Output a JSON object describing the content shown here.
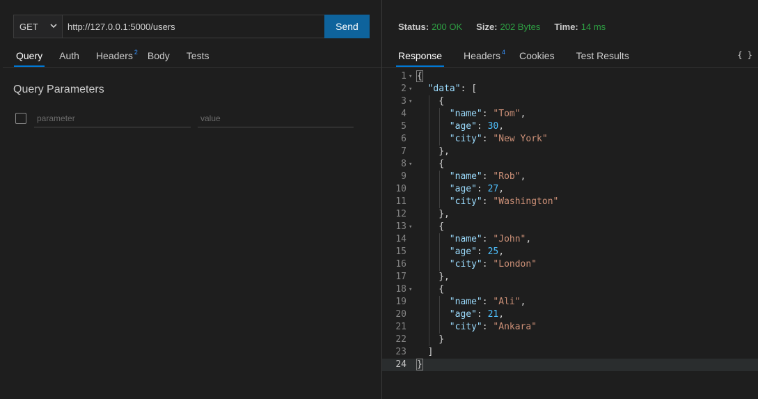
{
  "request": {
    "method": "GET",
    "url": "http://127.0.0.1:5000/users",
    "send_label": "Send"
  },
  "request_tabs": [
    {
      "label": "Query",
      "active": true,
      "badge": ""
    },
    {
      "label": "Auth",
      "active": false,
      "badge": ""
    },
    {
      "label": "Headers",
      "active": false,
      "badge": "2"
    },
    {
      "label": "Body",
      "active": false,
      "badge": ""
    },
    {
      "label": "Tests",
      "active": false,
      "badge": ""
    }
  ],
  "query": {
    "title": "Query Parameters",
    "param_placeholder": "parameter",
    "value_placeholder": "value"
  },
  "status": {
    "status_label": "Status:",
    "status_value": "200 OK",
    "size_label": "Size:",
    "size_value": "202 Bytes",
    "time_label": "Time:",
    "time_value": "14 ms"
  },
  "response_tabs": [
    {
      "label": "Response",
      "active": true,
      "badge": ""
    },
    {
      "label": "Headers",
      "active": false,
      "badge": "4"
    },
    {
      "label": "Cookies",
      "active": false,
      "badge": ""
    },
    {
      "label": "Test Results",
      "active": false,
      "badge": ""
    }
  ],
  "braces_icon": "{ }",
  "colors": {
    "accent": "#0078d4",
    "send_button": "#0e639c",
    "status_green": "#2ea043",
    "json_key": "#9cdcfe",
    "json_string": "#ce9178",
    "json_number": "#b5cea8"
  },
  "response_body": [
    {
      "n": "1",
      "fold": true,
      "indent": 0,
      "tokens": [
        [
          "p",
          "{"
        ]
      ]
    },
    {
      "n": "2",
      "fold": true,
      "indent": 1,
      "tokens": [
        [
          "k",
          "\"data\""
        ],
        [
          "p",
          ": ["
        ]
      ]
    },
    {
      "n": "3",
      "fold": true,
      "indent": 2,
      "tokens": [
        [
          "p",
          "{"
        ]
      ]
    },
    {
      "n": "4",
      "fold": false,
      "indent": 3,
      "tokens": [
        [
          "k",
          "\"name\""
        ],
        [
          "p",
          ": "
        ],
        [
          "s",
          "\"Tom\""
        ],
        [
          "p",
          ","
        ]
      ]
    },
    {
      "n": "5",
      "fold": false,
      "indent": 3,
      "tokens": [
        [
          "k",
          "\"age\""
        ],
        [
          "p",
          ": "
        ],
        [
          "n",
          "30"
        ],
        [
          "p",
          ","
        ]
      ]
    },
    {
      "n": "6",
      "fold": false,
      "indent": 3,
      "tokens": [
        [
          "k",
          "\"city\""
        ],
        [
          "p",
          ": "
        ],
        [
          "s",
          "\"New York\""
        ]
      ]
    },
    {
      "n": "7",
      "fold": false,
      "indent": 2,
      "tokens": [
        [
          "p",
          "},"
        ]
      ]
    },
    {
      "n": "8",
      "fold": true,
      "indent": 2,
      "tokens": [
        [
          "p",
          "{"
        ]
      ]
    },
    {
      "n": "9",
      "fold": false,
      "indent": 3,
      "tokens": [
        [
          "k",
          "\"name\""
        ],
        [
          "p",
          ": "
        ],
        [
          "s",
          "\"Rob\""
        ],
        [
          "p",
          ","
        ]
      ]
    },
    {
      "n": "10",
      "fold": false,
      "indent": 3,
      "tokens": [
        [
          "k",
          "\"age\""
        ],
        [
          "p",
          ": "
        ],
        [
          "n",
          "27"
        ],
        [
          "p",
          ","
        ]
      ]
    },
    {
      "n": "11",
      "fold": false,
      "indent": 3,
      "tokens": [
        [
          "k",
          "\"city\""
        ],
        [
          "p",
          ": "
        ],
        [
          "s",
          "\"Washington\""
        ]
      ]
    },
    {
      "n": "12",
      "fold": false,
      "indent": 2,
      "tokens": [
        [
          "p",
          "},"
        ]
      ]
    },
    {
      "n": "13",
      "fold": true,
      "indent": 2,
      "tokens": [
        [
          "p",
          "{"
        ]
      ]
    },
    {
      "n": "14",
      "fold": false,
      "indent": 3,
      "tokens": [
        [
          "k",
          "\"name\""
        ],
        [
          "p",
          ": "
        ],
        [
          "s",
          "\"John\""
        ],
        [
          "p",
          ","
        ]
      ]
    },
    {
      "n": "15",
      "fold": false,
      "indent": 3,
      "tokens": [
        [
          "k",
          "\"age\""
        ],
        [
          "p",
          ": "
        ],
        [
          "n",
          "25"
        ],
        [
          "p",
          ","
        ]
      ]
    },
    {
      "n": "16",
      "fold": false,
      "indent": 3,
      "tokens": [
        [
          "k",
          "\"city\""
        ],
        [
          "p",
          ": "
        ],
        [
          "s",
          "\"London\""
        ]
      ]
    },
    {
      "n": "17",
      "fold": false,
      "indent": 2,
      "tokens": [
        [
          "p",
          "},"
        ]
      ]
    },
    {
      "n": "18",
      "fold": true,
      "indent": 2,
      "tokens": [
        [
          "p",
          "{"
        ]
      ]
    },
    {
      "n": "19",
      "fold": false,
      "indent": 3,
      "tokens": [
        [
          "k",
          "\"name\""
        ],
        [
          "p",
          ": "
        ],
        [
          "s",
          "\"Ali\""
        ],
        [
          "p",
          ","
        ]
      ]
    },
    {
      "n": "20",
      "fold": false,
      "indent": 3,
      "tokens": [
        [
          "k",
          "\"age\""
        ],
        [
          "p",
          ": "
        ],
        [
          "n",
          "21"
        ],
        [
          "p",
          ","
        ]
      ]
    },
    {
      "n": "21",
      "fold": false,
      "indent": 3,
      "tokens": [
        [
          "k",
          "\"city\""
        ],
        [
          "p",
          ": "
        ],
        [
          "s",
          "\"Ankara\""
        ]
      ]
    },
    {
      "n": "22",
      "fold": false,
      "indent": 2,
      "tokens": [
        [
          "p",
          "}"
        ]
      ]
    },
    {
      "n": "23",
      "fold": false,
      "indent": 1,
      "tokens": [
        [
          "p",
          "]"
        ]
      ]
    },
    {
      "n": "24",
      "fold": false,
      "indent": 0,
      "tokens": [
        [
          "p",
          "}"
        ]
      ],
      "current": true
    }
  ]
}
